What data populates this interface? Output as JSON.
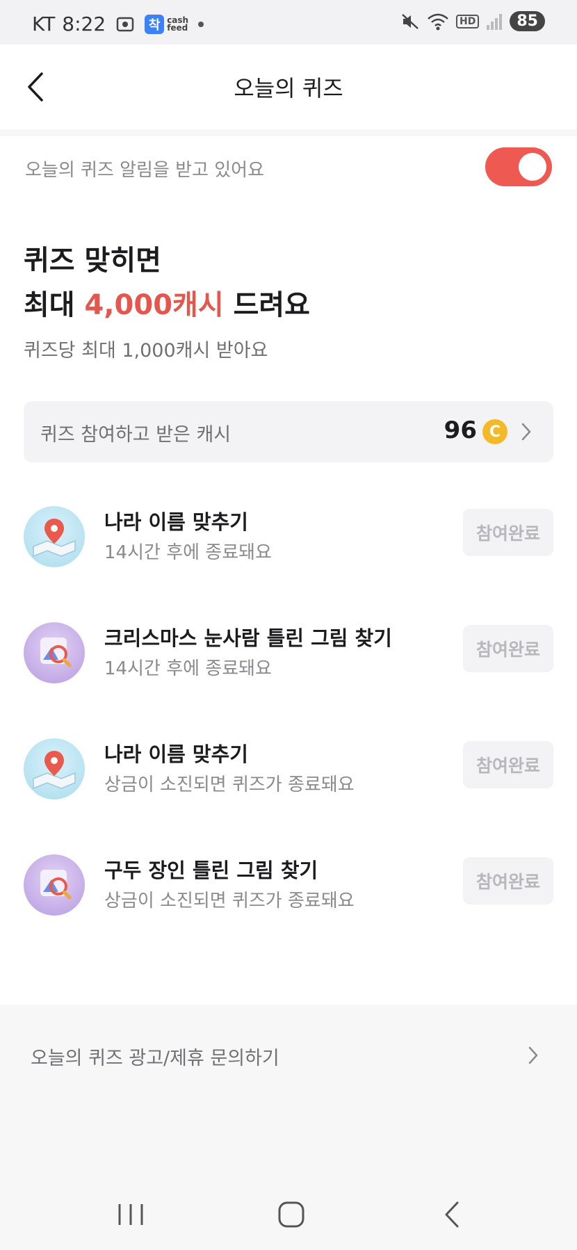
{
  "status_bar": {
    "carrier": "KT",
    "time": "8:22",
    "app_badge": "착",
    "app_name_line1": "cash",
    "app_name_line2": "feed",
    "hd_label": "HD",
    "battery": "85"
  },
  "header": {
    "title": "오늘의 퀴즈"
  },
  "notification": {
    "label": "오늘의 퀴즈 알림을 받고 있어요",
    "enabled": true,
    "toggle_color": "#ee5a52"
  },
  "hero": {
    "line1": "퀴즈 맞히면",
    "line2_prefix": "최대 ",
    "line2_accent": "4,000캐시",
    "line2_suffix": " 드려요",
    "subtitle": "퀴즈당 최대 1,000캐시 받아요",
    "accent_color": "#e5564d"
  },
  "cash_summary": {
    "label": "퀴즈 참여하고 받은 캐시",
    "value": "96",
    "coin_symbol": "C"
  },
  "quizzes": [
    {
      "icon": "map-pin-icon",
      "title": "나라 이름 맞추기",
      "subtitle": "14시간 후에 종료돼요",
      "status": "참여완료"
    },
    {
      "icon": "picture-search-icon",
      "title": "크리스마스 눈사람 틀린 그림 찾기",
      "subtitle": "14시간 후에 종료돼요",
      "status": "참여완료"
    },
    {
      "icon": "map-pin-icon",
      "title": "나라 이름 맞추기",
      "subtitle": "상금이 소진되면 퀴즈가 종료돼요",
      "status": "참여완료"
    },
    {
      "icon": "picture-search-icon",
      "title": "구두 장인 틀린 그림 찾기",
      "subtitle": "상금이 소진되면 퀴즈가 종료돼요",
      "status": "참여완료"
    }
  ],
  "footer": {
    "link_label": "오늘의 퀴즈 광고/제휴 문의하기"
  }
}
